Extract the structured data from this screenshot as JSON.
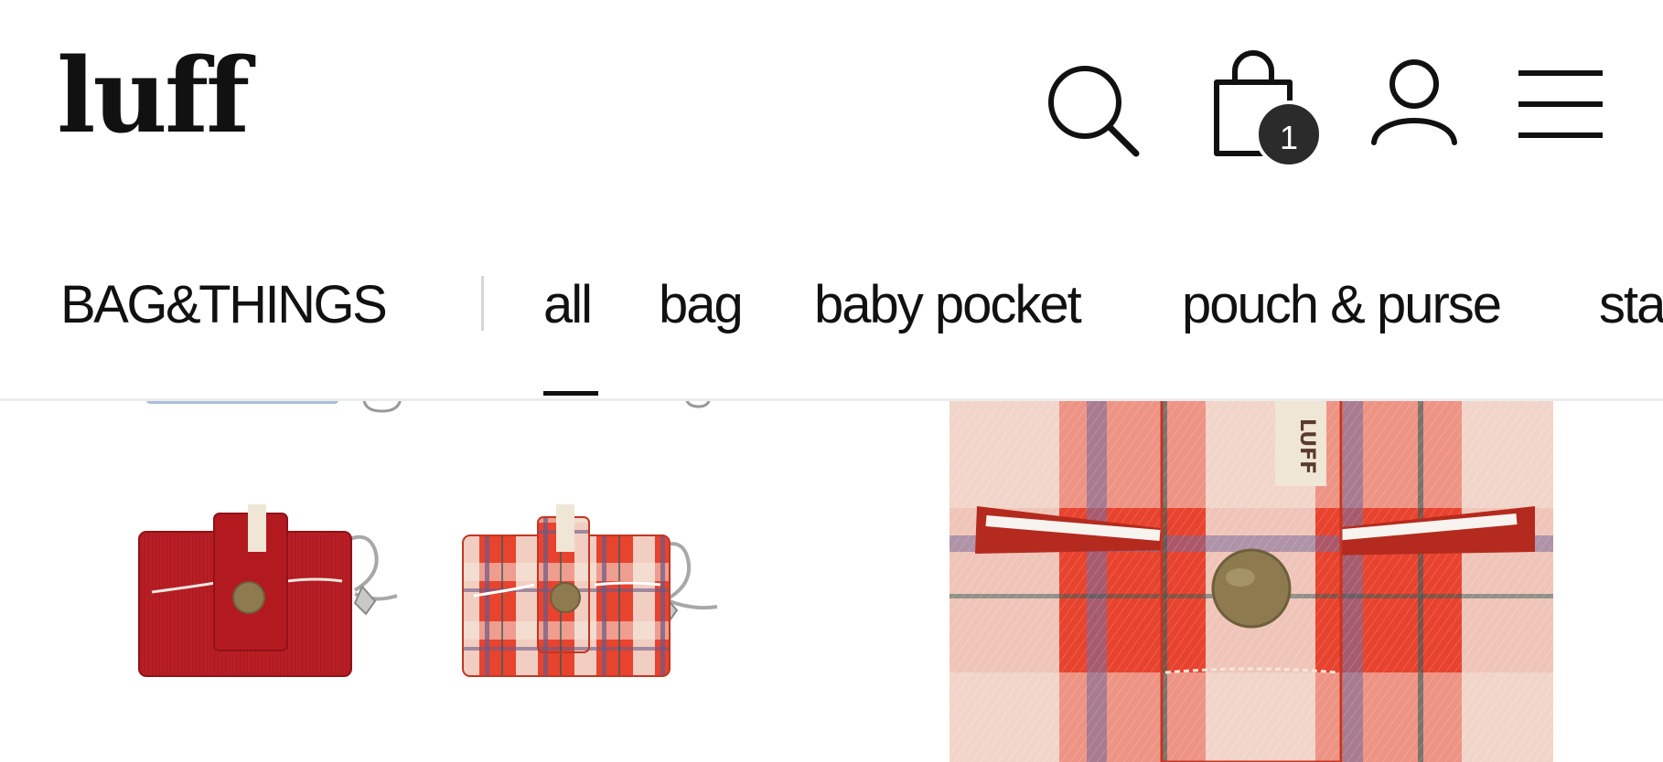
{
  "header": {
    "logo": "luff",
    "cart_count": "1",
    "icons": [
      "search-icon",
      "shopping-bag-icon",
      "user-icon",
      "hamburger-menu-icon"
    ]
  },
  "category_nav": {
    "title": "BAG&THINGS",
    "tabs": [
      {
        "label": "all",
        "active": true
      },
      {
        "label": "bag",
        "active": false
      },
      {
        "label": "baby pocket",
        "active": false
      },
      {
        "label": "pouch & purse",
        "active": false
      },
      {
        "label": "sta",
        "active": false
      }
    ]
  },
  "products": {
    "thumbnails": [
      {
        "variant": "red corduroy card wallet",
        "color": "#b81e24"
      },
      {
        "variant": "red check card wallet",
        "color": "#e8432e"
      }
    ],
    "featured": {
      "variant": "red check card wallet close-up",
      "label": "LUFF",
      "color": "#e8432e"
    }
  },
  "colors": {
    "text": "#111111",
    "badge": "#2b2b2b",
    "divider": "#d5d5d5",
    "plaid_red": "#e8432e",
    "corduroy_red": "#b81e24",
    "snap_brass": "#8d7a4e"
  }
}
